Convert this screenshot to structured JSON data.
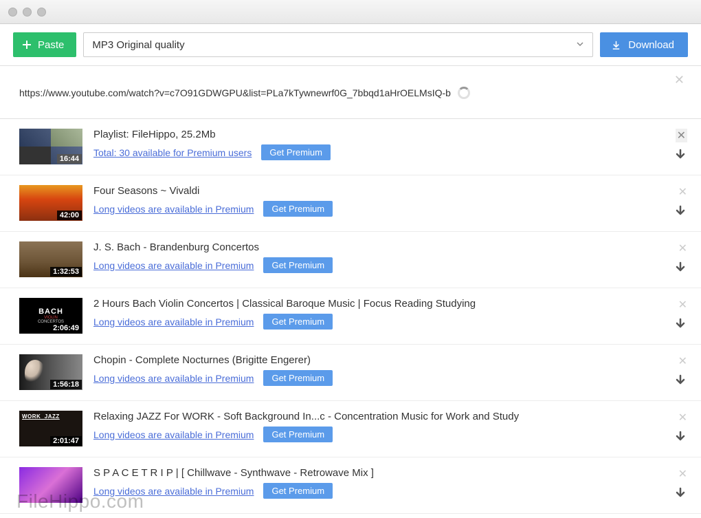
{
  "toolbar": {
    "paste_label": "Paste",
    "quality_selected": "MP3 Original quality",
    "download_label": "Download"
  },
  "url_bar": {
    "url": "https://www.youtube.com/watch?v=c7O91GDWGPU&list=PLa7kTywnewrf0G_7bbqd1aHrOELMsIQ-b"
  },
  "items": [
    {
      "title": "Playlist: FileHippo, 25.2Mb",
      "link_text": "Total: 30 available for Premium users",
      "duration": "16:44",
      "premium_label": "Get Premium",
      "thumb_type": "playlist",
      "close_dark": true
    },
    {
      "title": "Four Seasons ~ Vivaldi",
      "link_text": "Long videos are available in Premium",
      "duration": "42:00",
      "premium_label": "Get Premium",
      "thumb_type": "autumn"
    },
    {
      "title": "J. S. Bach - Brandenburg Concertos",
      "link_text": "Long videos are available in Premium",
      "duration": "1:32:53",
      "premium_label": "Get Premium",
      "thumb_type": "church"
    },
    {
      "title": "2 Hours Bach Violin Concertos | Classical Baroque Music | Focus Reading Studying",
      "link_text": "Long videos are available in Premium",
      "duration": "2:06:49",
      "premium_label": "Get Premium",
      "thumb_type": "bach"
    },
    {
      "title": "Chopin - Complete Nocturnes (Brigitte Engerer)",
      "link_text": "Long videos are available in Premium",
      "duration": "1:56:18",
      "premium_label": "Get Premium",
      "thumb_type": "chopin"
    },
    {
      "title": "Relaxing JAZZ For WORK - Soft Background In...c - Concentration Music for Work and Study",
      "link_text": "Long videos are available in Premium",
      "duration": "2:01:47",
      "premium_label": "Get Premium",
      "thumb_type": "jazz"
    },
    {
      "title": "S P A C E  T R I P  |  [ Chillwave - Synthwave - Retrowave Mix ]",
      "link_text": "Long videos are available in Premium",
      "duration": "",
      "premium_label": "Get Premium",
      "thumb_type": "space"
    }
  ],
  "watermark": "FileHippo.com"
}
